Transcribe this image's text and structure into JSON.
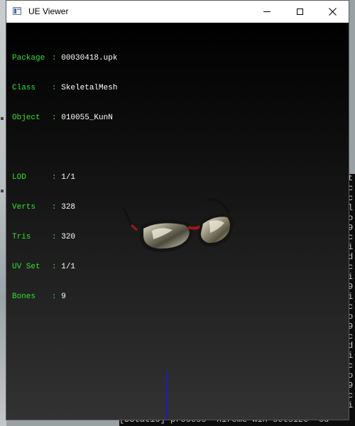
{
  "window": {
    "title": "UE Viewer",
    "icon": "app-window-icon",
    "controls": [
      "minimize-icon",
      "maximize-icon",
      "close-icon"
    ]
  },
  "info": {
    "object_rows": [
      {
        "key": "Package",
        "value": "00030418.upk"
      },
      {
        "key": "Class",
        "value": "SkeletalMesh"
      },
      {
        "key": "Object",
        "value": "010055_KunN"
      }
    ],
    "mesh_rows": [
      {
        "key": "LOD",
        "value": "1/1"
      },
      {
        "key": "Verts",
        "value": "328"
      },
      {
        "key": "Tris",
        "value": "320"
      },
      {
        "key": "UV Set",
        "value": "1/1"
      },
      {
        "key": "Bones",
        "value": "9"
      }
    ],
    "separator": ":"
  },
  "colors": {
    "label": "#33e033",
    "value": "#ffffff",
    "axis": "#1a1ad0"
  },
  "background": {
    "console_bottom": "[DStatic] process  hireme win setsize  cu"
  }
}
